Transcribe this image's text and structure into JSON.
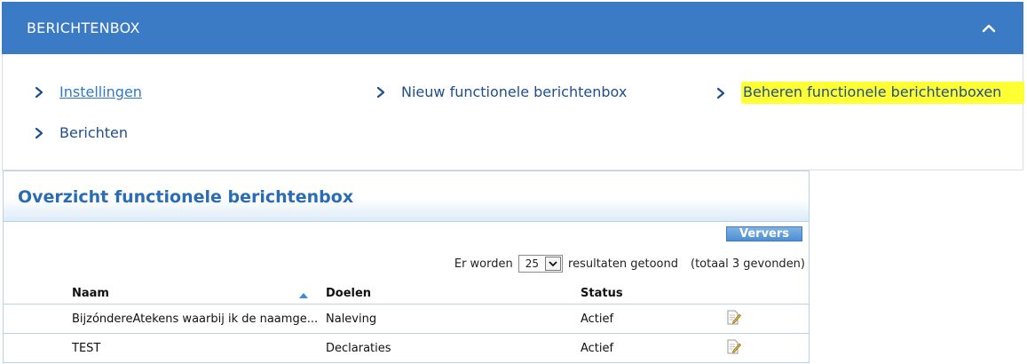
{
  "header": {
    "title": "BERICHTENBOX",
    "collapse_icon": "chevron-up-icon"
  },
  "nav": {
    "links": [
      {
        "label": "Instellingen"
      },
      {
        "label": "Nieuw functionele berichtenbox"
      },
      {
        "label": "Beheren functionele berichtenboxen"
      },
      {
        "label": "Berichten"
      }
    ],
    "highlight_color": "#ffff33"
  },
  "overview": {
    "title": "Overzicht functionele berichtenbox",
    "refresh_label": "Ververs",
    "results_prefix": "Er worden",
    "page_size": "25",
    "results_suffix": "resultaten getoond",
    "total_text": "(totaal 3 gevonden)",
    "columns": {
      "name": "Naam",
      "goals": "Doelen",
      "status": "Status"
    },
    "rows": [
      {
        "name": "BijzóndereAtekens waarbij ik de naamge...",
        "goals": "Naleving",
        "status": "Actief"
      },
      {
        "name": "TEST",
        "goals": "Declaraties",
        "status": "Actief"
      }
    ]
  },
  "colors": {
    "header_bg": "#3b7ac4",
    "link": "#1f4e8c",
    "title_blue": "#2a6cb3"
  }
}
